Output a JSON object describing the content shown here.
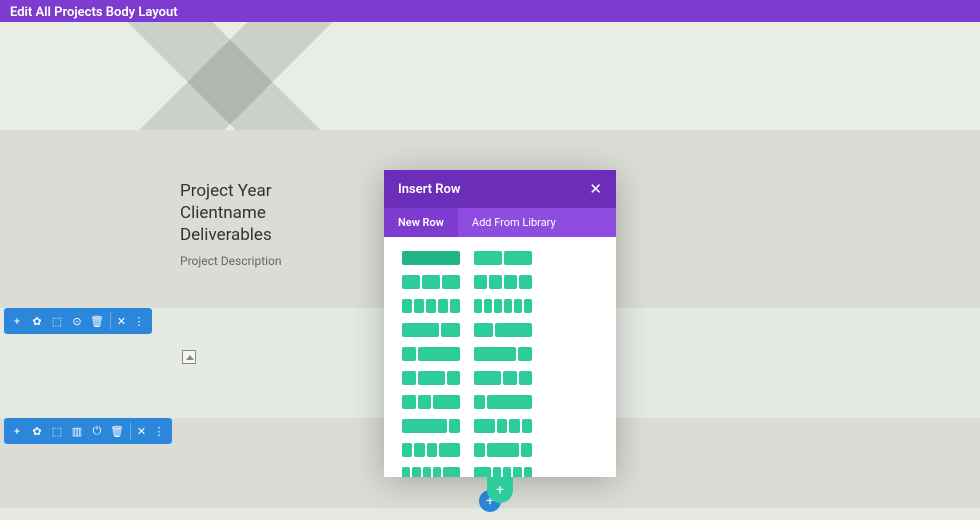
{
  "topbar": {
    "title": "Edit All Projects Body Layout"
  },
  "content": {
    "heading_line1": "Project Year",
    "heading_line2": "Clientname",
    "heading_line3": "Deliverables",
    "description": "Project Description"
  },
  "modal": {
    "title": "Insert Row",
    "close": "✕",
    "tabs": {
      "new_row": "New Row",
      "from_library": "Add From Library"
    }
  },
  "toolbar": {
    "add": "+",
    "settings": "✿",
    "duplicate": "⬚",
    "save": "⊙",
    "columns": "▥",
    "power": "⏻",
    "delete": "🗑",
    "close": "✕",
    "more": "⋮"
  },
  "add_button": "+"
}
